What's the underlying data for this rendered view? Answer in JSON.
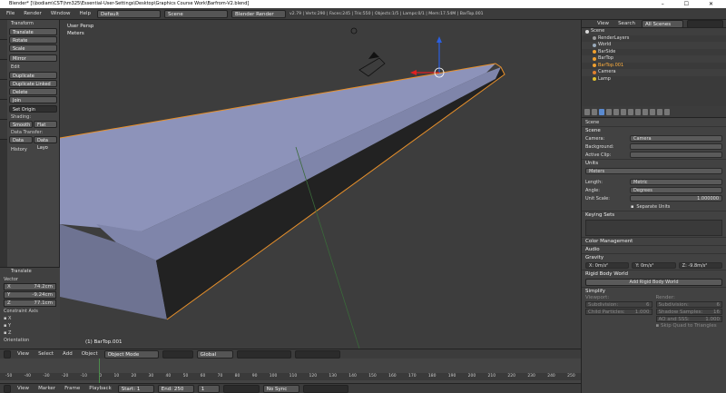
{
  "titlebar": {
    "title": "Blender* [\\\\bodiam\\CST\\hm325\\Essential-User-Settings\\Desktop\\Graphics Course Work\\Barfrom-V2.blend]",
    "controls": "– ☐ ✕"
  },
  "topbar": {
    "menus": [
      "File",
      "Render",
      "Window",
      "Help"
    ],
    "layout": "Default",
    "scene": "Scene",
    "engine": "Blender Render",
    "stats": "v2.79 | Verts:290 | Faces:245 | Tris:550 | Objects:1/5 | Lamps:0/1 | Mem:17.54M | BarTop.001"
  },
  "toolshelf": {
    "transform_title": "Transform",
    "transform_buttons": [
      "Translate",
      "Rotate",
      "Scale",
      "Mirror"
    ],
    "edit_title": "Edit",
    "edit_buttons": [
      "Duplicate",
      "Duplicate Linked",
      "Delete",
      "Join"
    ],
    "set_origin": "Set Origin",
    "shading_label": "Shading:",
    "shading": [
      "Smooth",
      "Flat"
    ],
    "data_transfer_label": "Data Transfer:",
    "data_transfer": [
      "Data",
      "Data Layo"
    ],
    "history": "History",
    "op_title": "Translate",
    "vector_label": "Vector",
    "vector": [
      {
        "axis": "X",
        "value": "74.2cm"
      },
      {
        "axis": "Y",
        "value": "-9.24cm"
      },
      {
        "axis": "Z",
        "value": "77.1cm"
      }
    ],
    "constraint_label": "Constraint Axis",
    "constraint_axes": [
      "X",
      "Y",
      "Z"
    ],
    "orientation": "Orientation"
  },
  "viewport": {
    "view_name": "User Persp",
    "units": "Meters",
    "object_label": "(1) BarTop.001"
  },
  "vheader": {
    "menus": [
      "View",
      "Select",
      "Add",
      "Object"
    ],
    "mode": "Object Mode",
    "orientation": "Global"
  },
  "timeline": {
    "ticks": [
      "-50",
      "-40",
      "-30",
      "-20",
      "-10",
      "0",
      "10",
      "20",
      "30",
      "40",
      "50",
      "60",
      "70",
      "80",
      "90",
      "100",
      "110",
      "120",
      "130",
      "140",
      "150",
      "160",
      "170",
      "180",
      "190",
      "200",
      "210",
      "220",
      "230",
      "240",
      "250"
    ]
  },
  "tlbar": {
    "menus": [
      "View",
      "Marker",
      "Frame",
      "Playback"
    ],
    "start_label": "Start:",
    "start": "1",
    "end_label": "End:",
    "end": "250",
    "current": "1",
    "sync": "No Sync"
  },
  "outliner": {
    "menus": [
      "View",
      "Search"
    ],
    "filter": "All Scenes",
    "items": [
      {
        "name": "Scene",
        "color": "#d8d8d8"
      },
      {
        "name": "RenderLayers",
        "color": "#999"
      },
      {
        "name": "World",
        "color": "#9ab"
      },
      {
        "name": "BarSide",
        "color": "#f0a030"
      },
      {
        "name": "BarTop",
        "color": "#f0a030"
      },
      {
        "name": "BarTop.001",
        "color": "#f0a030"
      },
      {
        "name": "Camera",
        "color": "#e08030"
      },
      {
        "name": "Lamp",
        "color": "#e0c030"
      }
    ]
  },
  "props": {
    "breadcrumb": "Scene",
    "scene_section": "Scene",
    "camera_label": "Camera:",
    "camera": "Camera",
    "background_label": "Background:",
    "active_clip_label": "Active Clip:",
    "units_section": "Units",
    "unit_preset": "Meters",
    "length_label": "Length:",
    "length": "Metric",
    "angle_label": "Angle:",
    "angle": "Degrees",
    "unit_scale_label": "Unit Scale:",
    "unit_scale": "1.000000",
    "separate_units": "Separate Units",
    "keying_section": "Keying Sets",
    "color_mgmt": "Color Management",
    "audio": "Audio",
    "gravity": "Gravity",
    "gx_label": "X:",
    "gx": "0m/s²",
    "gy_label": "Y:",
    "gy": "0m/s²",
    "gz_label": "Z:",
    "gz": "-9.8m/s²",
    "rbw_section": "Rigid Body World",
    "add_rbw": "Add Rigid Body World",
    "simplify": "Simplify",
    "viewport_label": "Viewport:",
    "render_label": "Render:",
    "subdivision_label": "Subdivision:",
    "subdivision_vp": "6",
    "subdivision_r": "6",
    "child_particles_label": "Child Particles:",
    "child_particles": "1.000",
    "shadow_samples_label": "Shadow Samples:",
    "shadow_samples": "16",
    "ao_sss_label": "AO and SSS:",
    "ao_sss": "1.000",
    "skip_quad": "Skip Quad to Triangles"
  }
}
